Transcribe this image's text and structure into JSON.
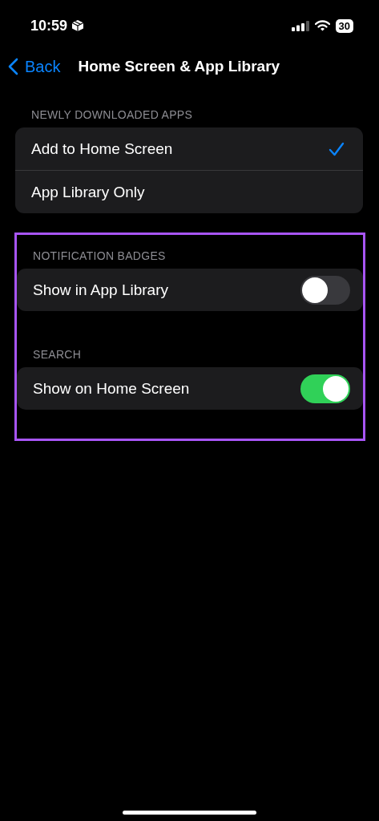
{
  "status_bar": {
    "time": "10:59",
    "battery": "30"
  },
  "nav": {
    "back": "Back",
    "title": "Home Screen & App Library"
  },
  "sections": [
    {
      "header": "NEWLY DOWNLOADED APPS",
      "highlighted": false,
      "rows": [
        {
          "kind": "check",
          "label": "Add to Home Screen",
          "selected": true
        },
        {
          "kind": "check",
          "label": "App Library Only",
          "selected": false
        }
      ]
    },
    {
      "header": "NOTIFICATION BADGES",
      "highlighted": true,
      "rows": [
        {
          "kind": "toggle",
          "label": "Show in App Library",
          "on": false
        }
      ]
    },
    {
      "header": "SEARCH",
      "highlighted": true,
      "rows": [
        {
          "kind": "toggle",
          "label": "Show on Home Screen",
          "on": true
        }
      ]
    }
  ]
}
